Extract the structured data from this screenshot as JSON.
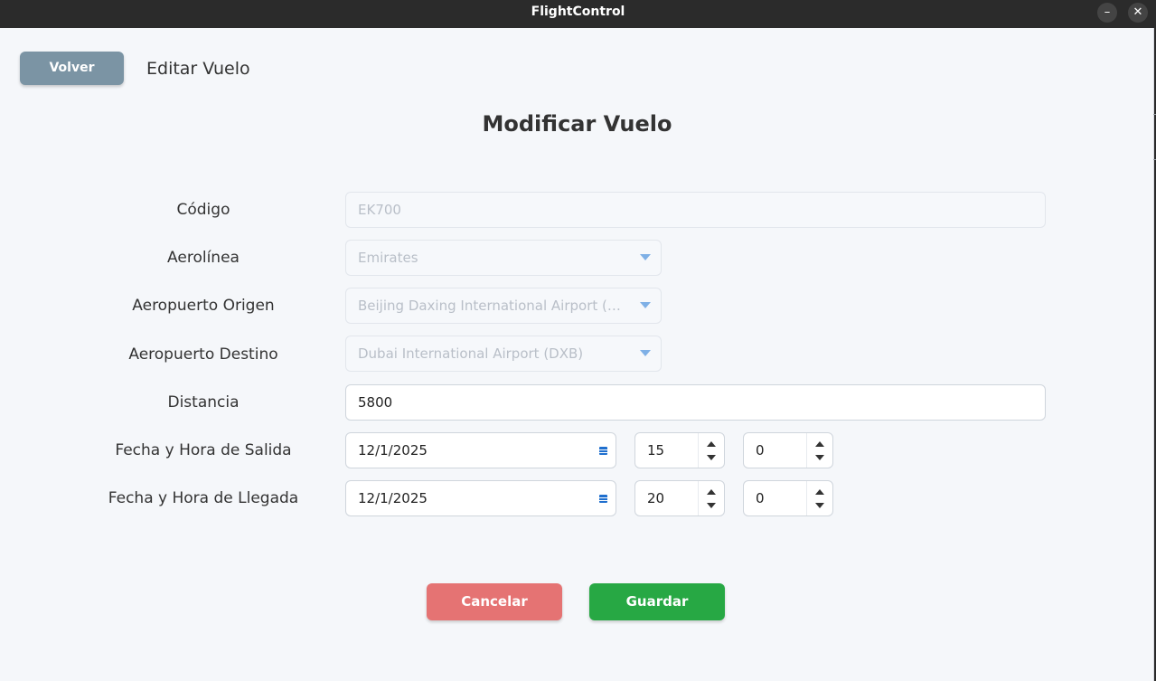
{
  "window": {
    "title": "FlightControl",
    "minimize_glyph": "–",
    "close_glyph": "✕"
  },
  "header": {
    "back_label": "Volver",
    "page_label": "Editar Vuelo"
  },
  "form": {
    "title": "Modificar Vuelo",
    "code": {
      "label": "Código",
      "value": "EK700"
    },
    "airline": {
      "label": "Aerolínea",
      "value": "Emirates"
    },
    "origin": {
      "label": "Aeropuerto Origen",
      "value": "Beijing Daxing International Airport (PKX)"
    },
    "destination": {
      "label": "Aeropuerto Destino",
      "value": "Dubai International Airport (DXB)"
    },
    "distance": {
      "label": "Distancia",
      "value": "5800"
    },
    "departure": {
      "label": "Fecha y Hora de Salida",
      "date": "12/1/2025",
      "hour": "15",
      "minute": "0"
    },
    "arrival": {
      "label": "Fecha y Hora de Llegada",
      "date": "12/1/2025",
      "hour": "20",
      "minute": "0"
    }
  },
  "actions": {
    "cancel_label": "Cancelar",
    "save_label": "Guardar"
  },
  "icons": {
    "dropdown": "chevron-down-icon",
    "calendar": "calendar-icon",
    "spin_up": "arrow-up-icon",
    "spin_down": "arrow-down-icon"
  },
  "colors": {
    "back_button": "#7b94a4",
    "cancel_button": "#e57373",
    "save_button": "#27a844",
    "dropdown_caret": "#7fb0e6",
    "calendar_icon": "#1f6fce"
  }
}
